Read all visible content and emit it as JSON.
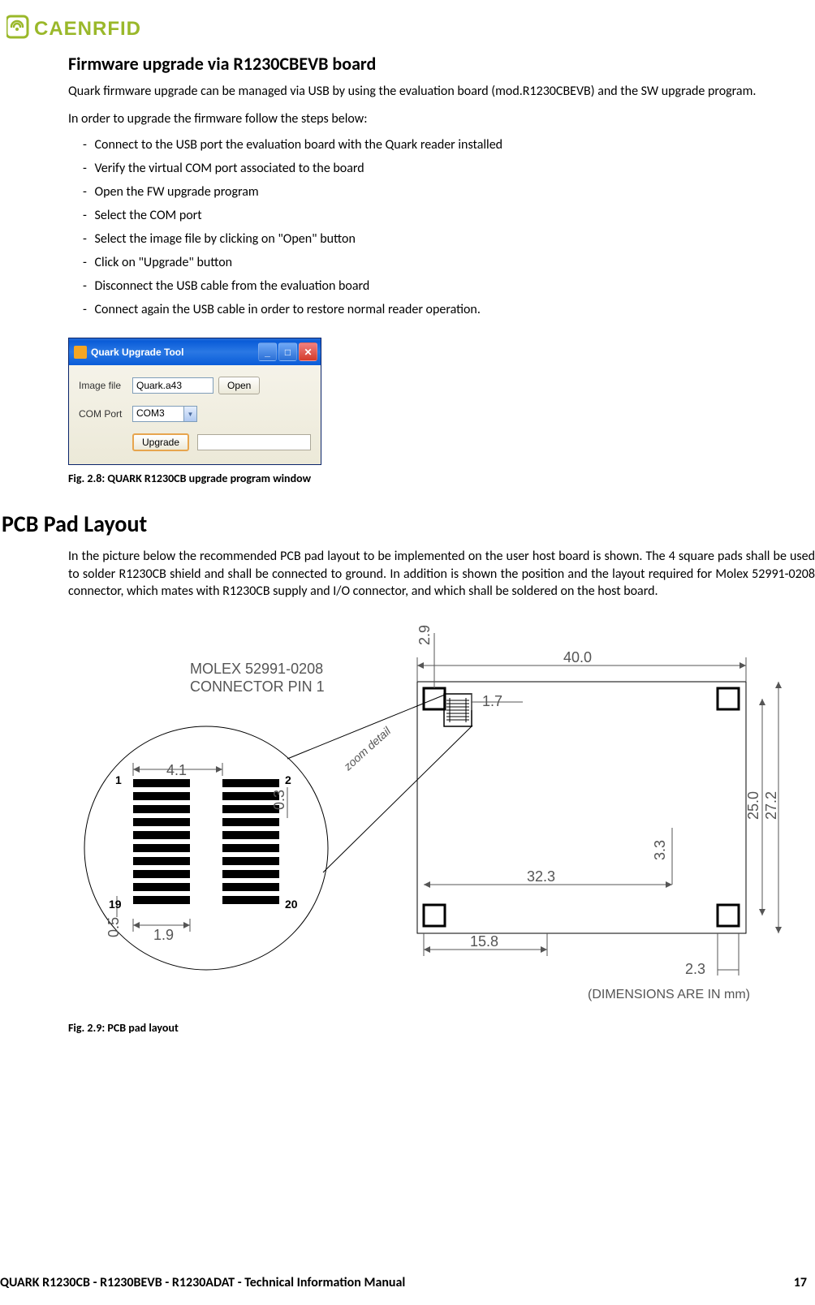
{
  "brand": "CAENRFID",
  "section1": {
    "title": "Firmware upgrade via R1230CBEVB board",
    "p1": "Quark firmware upgrade can be managed via USB by using the evaluation board (mod.R1230CBEVB) and the SW upgrade program.",
    "p2": "In order to upgrade the firmware follow the steps below:",
    "steps": [
      "Connect to the USB port the evaluation board with the Quark reader installed",
      "Verify the virtual COM port associated to the board",
      "Open the FW upgrade program",
      "Select the COM port",
      "Select the image file by clicking on \"Open\" button",
      "Click on \"Upgrade\" button",
      "Disconnect the USB cable from the evaluation board",
      "Connect again the USB cable in order to restore normal reader operation."
    ]
  },
  "tool": {
    "title": "Quark Upgrade Tool",
    "image_label": "Image file",
    "image_value": "Quark.a43",
    "open_btn": "Open",
    "com_label": "COM Port",
    "com_value": "COM3",
    "upgrade_btn": "Upgrade"
  },
  "fig1_caption": "Fig. 2.8: QUARK R1230CB upgrade program window",
  "section2": {
    "title": "PCB Pad Layout",
    "p1": "In the picture below the recommended PCB pad layout to be implemented on the user host board is shown. The 4 square pads shall be used to solder R1230CB shield and shall be connected to ground. In addition is shown the position and the layout required for Molex 52991-0208 connector, which mates with R1230CB supply and I/O connector, and which shall be soldered on the host board."
  },
  "diagram": {
    "connector_label_l1": "MOLEX 52991-0208",
    "connector_label_l2": "CONNECTOR PIN 1",
    "pin1": "1",
    "pin2": "2",
    "pin19": "19",
    "pin20": "20",
    "d_4_1": "4.1",
    "d_0_3": "0.3",
    "d_0_5": "0.5",
    "d_1_9": "1.9",
    "d_2_9": "2.9",
    "d_40_0": "40.0",
    "d_1_7": "1.7",
    "d_3_3": "3.3",
    "d_25_0": "25.0",
    "d_27_2": "27.2",
    "d_32_3": "32.3",
    "d_15_8": "15.8",
    "d_2_3": "2.3",
    "zoom": "zoom detail",
    "units": "(DIMENSIONS ARE IN mm)"
  },
  "fig2_caption": "Fig. 2.9: PCB pad layout",
  "footer_left": "QUARK R1230CB - R1230BEVB - R1230ADAT -  Technical Information Manual",
  "footer_right": "17"
}
